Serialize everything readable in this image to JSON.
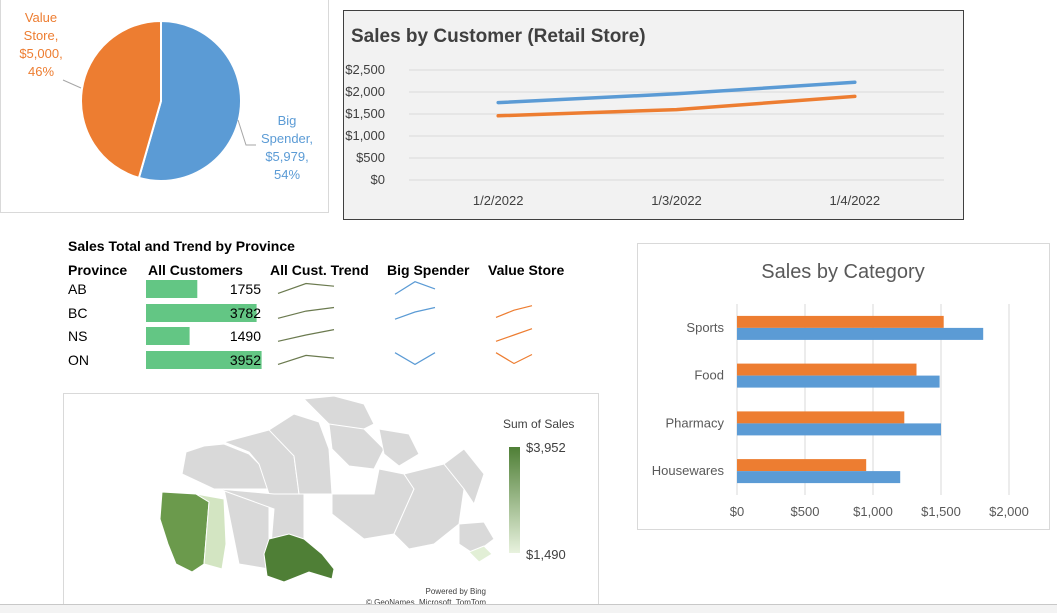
{
  "colors": {
    "blue": "#5b9bd5",
    "orange": "#ed7d31",
    "green": "#63c684",
    "green_dark": "#4f7f36",
    "green_light": "#dcebcf",
    "trend_gray": "#6b7a4f"
  },
  "pie": {
    "chart_data": {
      "type": "pie",
      "slices": [
        {
          "name": "Big Spender",
          "value": 5979,
          "value_label": "$5,979",
          "percent": "54%",
          "color": "#5b9bd5"
        },
        {
          "name": "Value Store",
          "value": 5000,
          "value_label": "$5,000",
          "percent": "46%",
          "color": "#ed7d31"
        }
      ]
    },
    "labels": {
      "value_store": [
        "Value",
        "Store,",
        "$5,000,",
        "46%"
      ],
      "big_spender": [
        "Big",
        "Spender,",
        "$5,979,",
        "54%"
      ]
    }
  },
  "line_chart": {
    "title": "Sales by Customer (Retail Store)",
    "chart_data": {
      "type": "line",
      "x": [
        "1/2/2022",
        "1/3/2022",
        "1/4/2022"
      ],
      "series": [
        {
          "values": [
            1760,
            1960,
            2220
          ],
          "color": "#5b9bd5"
        },
        {
          "values": [
            1460,
            1600,
            1900
          ],
          "color": "#ed7d31"
        }
      ],
      "ylim": [
        0,
        2500
      ],
      "yticks": [
        0,
        500,
        1000,
        1500,
        2000,
        2500
      ],
      "ytick_labels": [
        "$0",
        "$500",
        "$1,000",
        "$1,500",
        "$2,000",
        "$2,500"
      ],
      "grid": true
    }
  },
  "table": {
    "title": "Sales Total and Trend by Province",
    "headers": [
      "Province",
      "All Customers",
      "All Cust. Trend",
      "Big Spender",
      "Value Store"
    ],
    "rows": [
      {
        "province": "AB",
        "total": 1755,
        "trend_all": [
          0.2,
          0.75,
          0.6
        ],
        "trend_big": [
          0.15,
          0.85,
          0.45
        ],
        "trend_value": []
      },
      {
        "province": "BC",
        "total": 3782,
        "trend_all": [
          0.15,
          0.55,
          0.75
        ],
        "trend_big": [
          0.1,
          0.5,
          0.75
        ],
        "trend_value": [
          0.2,
          0.6,
          0.85
        ]
      },
      {
        "province": "NS",
        "total": 1490,
        "trend_all": [
          0.15,
          0.5,
          0.8
        ],
        "trend_big": [],
        "trend_value": [
          0.15,
          0.5,
          0.85
        ]
      },
      {
        "province": "ON",
        "total": 3952,
        "trend_all": [
          0.2,
          0.7,
          0.55
        ],
        "trend_big": [
          0.85,
          0.2,
          0.85
        ],
        "trend_value": [
          0.85,
          0.25,
          0.75
        ]
      }
    ],
    "bar_max": 4000
  },
  "map": {
    "legend_title": "Sum of Sales",
    "legend_max": "$3,952",
    "legend_min": "$1,490",
    "attribution_1": "Powered by Bing",
    "attribution_2": "© GeoNames, Microsoft, TomTom"
  },
  "bar_chart": {
    "title": "Sales by Category",
    "chart_data": {
      "type": "bar",
      "orientation": "horizontal",
      "categories": [
        "Sports",
        "Food",
        "Pharmacy",
        "Housewares"
      ],
      "series": [
        {
          "values": [
            1520,
            1320,
            1230,
            950
          ],
          "color": "#ed7d31"
        },
        {
          "values": [
            1810,
            1490,
            1500,
            1200
          ],
          "color": "#5b9bd5"
        }
      ],
      "xlim": [
        0,
        2000
      ],
      "xticks": [
        0,
        500,
        1000,
        1500,
        2000
      ],
      "xtick_labels": [
        "$0",
        "$500",
        "$1,000",
        "$1,500",
        "$2,000"
      ],
      "grid": true
    }
  }
}
